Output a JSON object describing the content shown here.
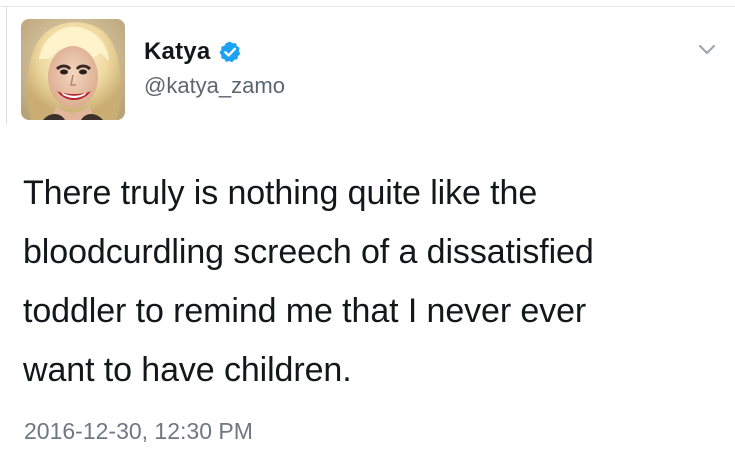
{
  "tweet": {
    "author": {
      "display_name": "Katya",
      "handle": "@katya_zamo",
      "verified": true,
      "avatar_icon": "profile-photo"
    },
    "text_lines": [
      "There truly is nothing quite like the",
      "bloodcurdling screech of a dissatisfied",
      "toddler to remind me that I never ever",
      "want to have children."
    ],
    "timestamp": "2016-12-30, 12:30 PM",
    "menu_icon": "chevron-down-icon"
  },
  "colors": {
    "text_primary": "#14171a",
    "text_secondary": "#5d6670",
    "verified_blue": "#1da1f2",
    "chevron": "#9aa4ad"
  }
}
